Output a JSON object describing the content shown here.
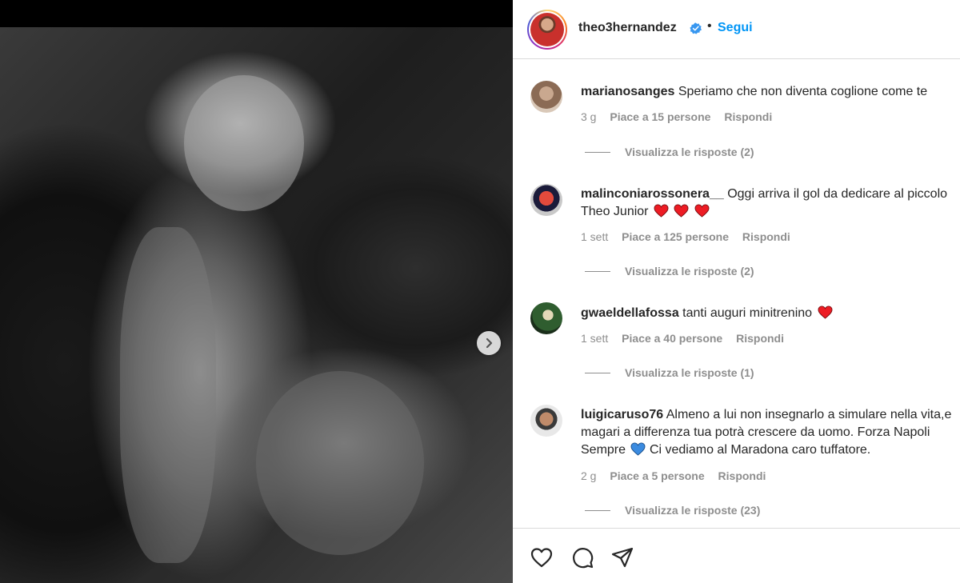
{
  "post": {
    "author": "theo3hernandez",
    "separator": "•",
    "follow_label": "Segui"
  },
  "comments": [
    {
      "user": "marianosanges",
      "text": "Speriamo che non diventa coglione come te",
      "time": "3 g",
      "likes": "Piace a 15 persone",
      "reply": "Rispondi",
      "view_replies": "Visualizza le risposte (2)"
    },
    {
      "user": "malinconiarossonera__",
      "text": "Oggi arriva il gol da dedicare al piccolo Theo Junior",
      "emoji": "red-heart x3",
      "time": "1 sett",
      "likes": "Piace a 125 persone",
      "reply": "Rispondi",
      "view_replies": "Visualizza le risposte (2)"
    },
    {
      "user": "gwaeldellafossa",
      "text": "tanti auguri minitrenino",
      "emoji": "red-heart",
      "time": "1 sett",
      "likes": "Piace a 40 persone",
      "reply": "Rispondi",
      "view_replies": "Visualizza le risposte (1)"
    },
    {
      "user": "luigicaruso76",
      "text_a": "Almeno a lui non insegnarlo a simulare nella vita,e magari a differenza tua potrà crescere da uomo. Forza Napoli Sempre",
      "text_b": "Ci vediamo al Maradona caro tuffatore.",
      "emoji": "blue-heart",
      "time": "2 g",
      "likes": "Piace a 5 persone",
      "reply": "Rispondi",
      "view_replies": "Visualizza le risposte (23)"
    }
  ],
  "icons": {
    "next": "chevron-right-icon",
    "verified": "verified-badge-icon",
    "like": "heart-outline-icon",
    "comment": "comment-bubble-icon",
    "share": "paper-plane-icon"
  },
  "colors": {
    "follow": "#0095f6",
    "verified": "#3897f0",
    "heart_red": "#ed1c24",
    "heart_blue": "#3b8be0",
    "text": "#262626",
    "muted": "#8e8e8e"
  }
}
